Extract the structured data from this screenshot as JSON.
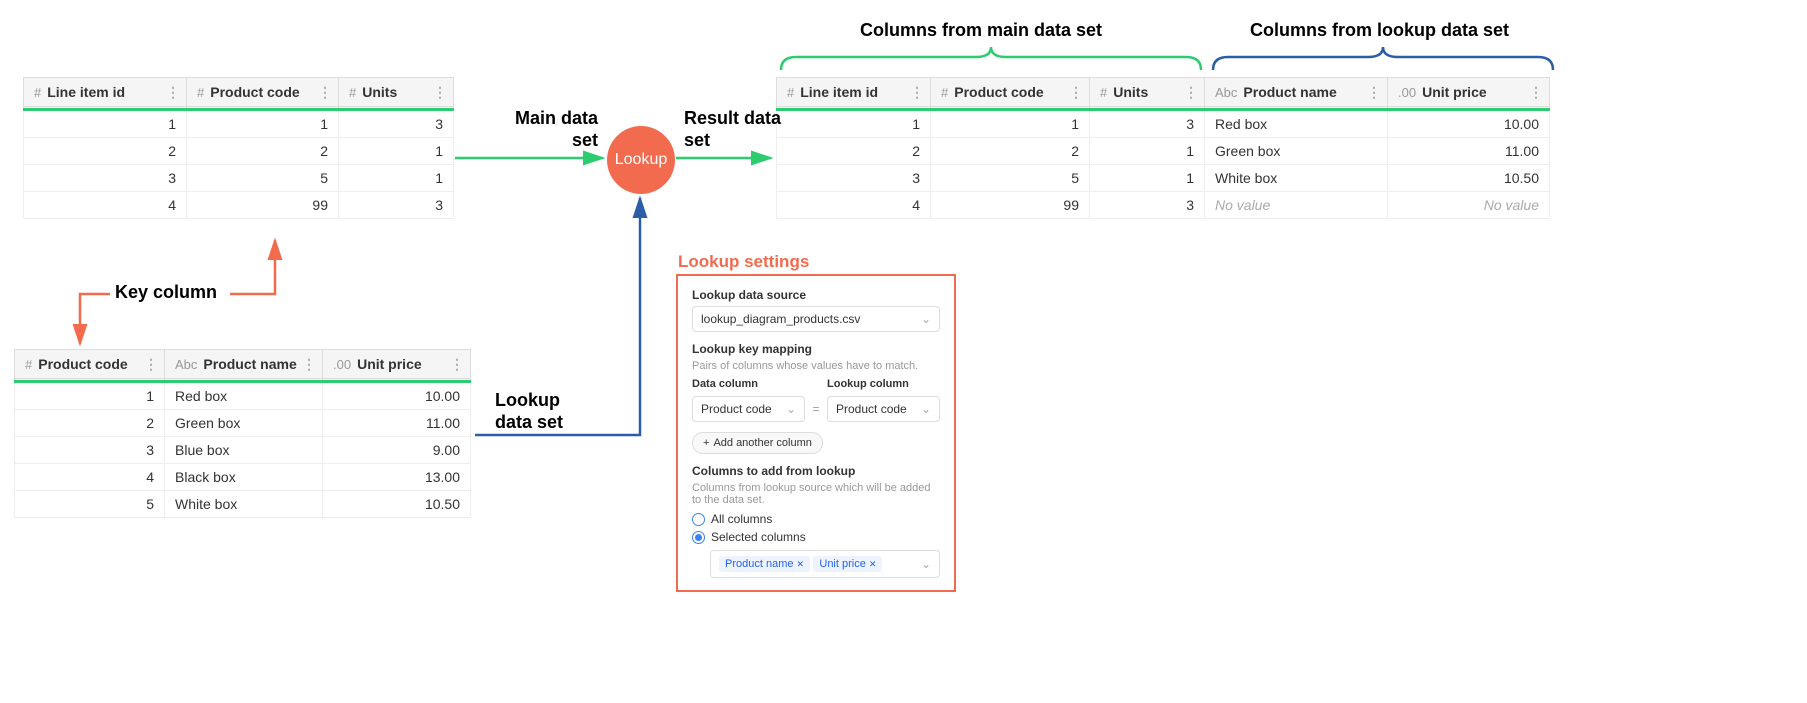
{
  "labels": {
    "main_data_set": "Main data set",
    "lookup_data_set": "Lookup data set",
    "result_data_set": "Result data set",
    "key_column": "Key column",
    "lookup_node": "Lookup",
    "cols_from_main": "Columns from main data set",
    "cols_from_lookup": "Columns from lookup data set",
    "lookup_settings": "Lookup settings"
  },
  "main_table": {
    "columns": [
      {
        "type": "#",
        "name": "Line item id"
      },
      {
        "type": "#",
        "name": "Product code"
      },
      {
        "type": "#",
        "name": "Units"
      }
    ],
    "rows": [
      [
        "1",
        "1",
        "3"
      ],
      [
        "2",
        "2",
        "1"
      ],
      [
        "3",
        "5",
        "1"
      ],
      [
        "4",
        "99",
        "3"
      ]
    ]
  },
  "lookup_table": {
    "columns": [
      {
        "type": "#",
        "name": "Product code"
      },
      {
        "type": "Abc",
        "name": "Product name"
      },
      {
        "type": ".00",
        "name": "Unit price"
      }
    ],
    "rows": [
      [
        "1",
        "Red box",
        "10.00"
      ],
      [
        "2",
        "Green box",
        "11.00"
      ],
      [
        "3",
        "Blue box",
        "9.00"
      ],
      [
        "4",
        "Black box",
        "13.00"
      ],
      [
        "5",
        "White box",
        "10.50"
      ]
    ]
  },
  "result_table": {
    "columns": [
      {
        "type": "#",
        "name": "Line item id"
      },
      {
        "type": "#",
        "name": "Product code"
      },
      {
        "type": "#",
        "name": "Units"
      },
      {
        "type": "Abc",
        "name": "Product name"
      },
      {
        "type": ".00",
        "name": "Unit price"
      }
    ],
    "rows": [
      [
        "1",
        "1",
        "3",
        "Red box",
        "10.00"
      ],
      [
        "2",
        "2",
        "1",
        "Green box",
        "11.00"
      ],
      [
        "3",
        "5",
        "1",
        "White box",
        "10.50"
      ],
      [
        "4",
        "99",
        "3",
        "No value",
        "No value"
      ]
    ]
  },
  "settings": {
    "data_source_label": "Lookup data source",
    "data_source_value": "lookup_diagram_products.csv",
    "key_mapping_label": "Lookup key mapping",
    "key_mapping_hint": "Pairs of columns whose values have to match.",
    "data_column_label": "Data column",
    "lookup_column_label": "Lookup column",
    "data_column_value": "Product code",
    "lookup_column_value": "Product code",
    "add_another": "Add another column",
    "cols_to_add_label": "Columns to add from lookup",
    "cols_to_add_hint": "Columns from lookup source which will be added to the data set.",
    "radio_all": "All columns",
    "radio_selected": "Selected columns",
    "chip1": "Product name",
    "chip2": "Unit price"
  }
}
